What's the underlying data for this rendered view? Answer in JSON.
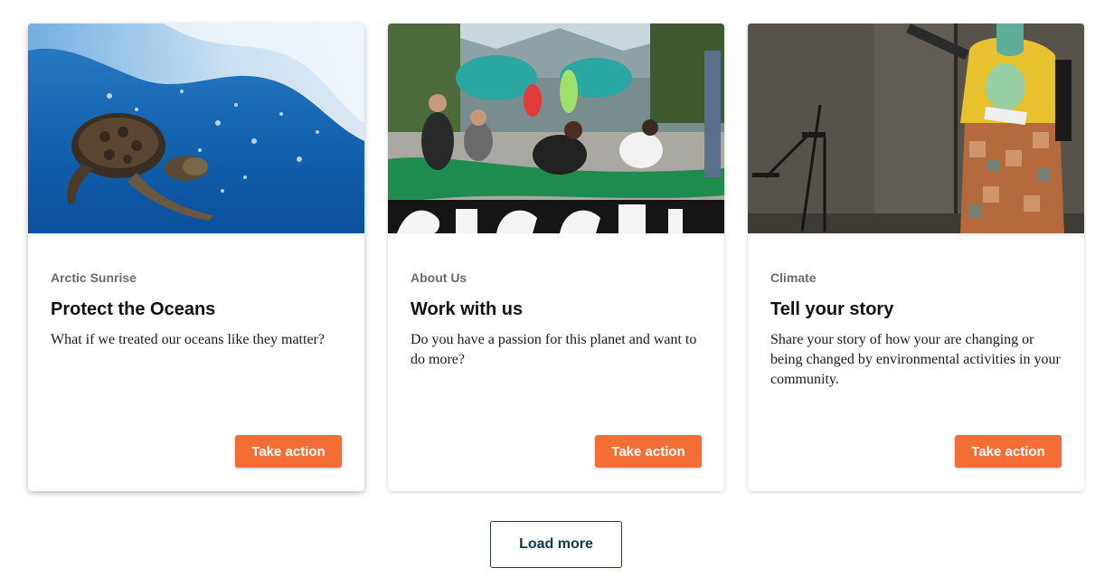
{
  "cards": [
    {
      "category": "Arctic Sunrise",
      "title": "Protect the Oceans",
      "description": "What if we treated our oceans like they matter?",
      "button_label": "Take action",
      "image": "sea-turtle-underwater-photo"
    },
    {
      "category": "About Us",
      "title": "Work with us",
      "description": "Do you have a passion for this planet and want to do more?",
      "button_label": "Take action",
      "image": "people-painting-street-mural-photo"
    },
    {
      "category": "Climate",
      "title": "Tell your story",
      "description": "Share your story of how your are changing or being changed by environmental activities in your community.",
      "button_label": "Take action",
      "image": "person-speaking-at-microphone-photo"
    }
  ],
  "load_more_label": "Load more",
  "colors": {
    "button_orange": "#f36e37",
    "load_more_border": "#1c3b4d",
    "category_gray": "#6b6b6b"
  }
}
